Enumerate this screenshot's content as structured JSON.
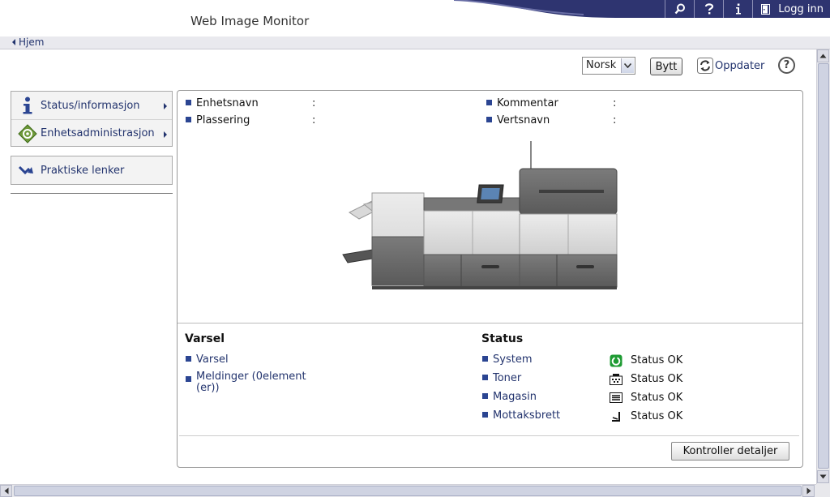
{
  "header": {
    "app_title": "Web Image Monitor",
    "login_label": "Logg inn",
    "tools": [
      "search-icon",
      "help-icon",
      "info-icon"
    ]
  },
  "breadcrumb": {
    "home_label": "Hjem"
  },
  "toolbar": {
    "language_value": "Norsk",
    "switch_label": "Bytt",
    "refresh_label": "Oppdater",
    "help_symbol": "?"
  },
  "sidebar": {
    "items": [
      {
        "label": "Status/informasjon",
        "icon": "info-icon"
      },
      {
        "label": "Enhetsadministrasjon",
        "icon": "device-admin-icon"
      }
    ],
    "links_label": "Praktiske lenker"
  },
  "device_info": {
    "name_label": "Enhetsnavn",
    "location_label": "Plassering",
    "comment_label": "Kommentar",
    "host_label": "Vertsnavn",
    "separator": ":"
  },
  "alerts": {
    "title": "Varsel",
    "links": [
      "Varsel",
      "Meldinger (0element",
      "(er))"
    ]
  },
  "status": {
    "title": "Status",
    "rows": [
      {
        "label": "System",
        "value": "Status OK",
        "icon": "system-ok-icon"
      },
      {
        "label": "Toner",
        "value": "Status OK",
        "icon": "toner-icon"
      },
      {
        "label": "Magasin",
        "value": "Status OK",
        "icon": "tray-icon"
      },
      {
        "label": "Mottaksbrett",
        "value": "Status OK",
        "icon": "output-tray-icon"
      }
    ]
  },
  "details_button": "Kontroller detaljer",
  "colors": {
    "header_navy": "#2e3470",
    "link_blue": "#23346e",
    "ok_green": "#1e9b33"
  }
}
